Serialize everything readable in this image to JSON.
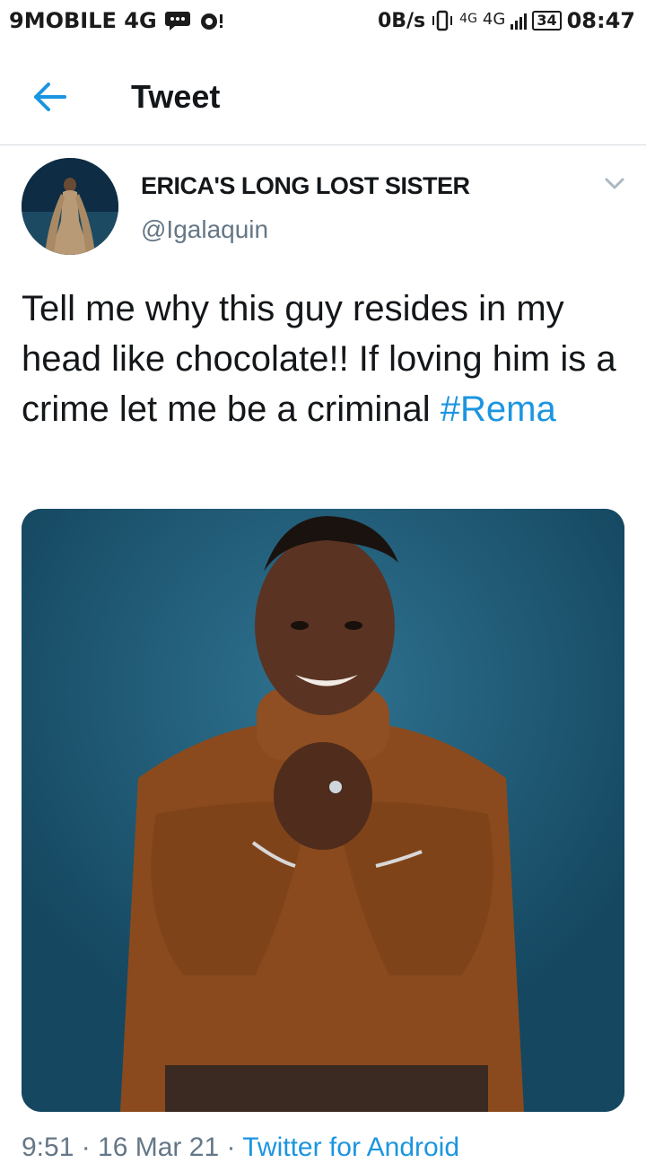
{
  "status_bar": {
    "carrier": "9MOBILE 4G",
    "speed": "0B/s",
    "network_small": "4G",
    "network": "4G",
    "battery": "34",
    "time": "08:47"
  },
  "app_bar": {
    "title": "Tweet",
    "back_icon": "arrow-left-icon"
  },
  "tweet": {
    "author_name": "ERICA'S LONG LOST SISTER",
    "author_handle": "@Igalaquin",
    "text": "Tell me why this guy resides in my head like chocolate!! If loving him is a crime let me be a criminal ",
    "hashtag": "#Rema",
    "meta_time": "9:51 · 16 Mar 21 · ",
    "meta_source": "Twitter for Android"
  },
  "colors": {
    "accent": "#1b95e0",
    "text_primary": "#14171a",
    "text_secondary": "#657786",
    "divider": "#d6dbe0"
  }
}
